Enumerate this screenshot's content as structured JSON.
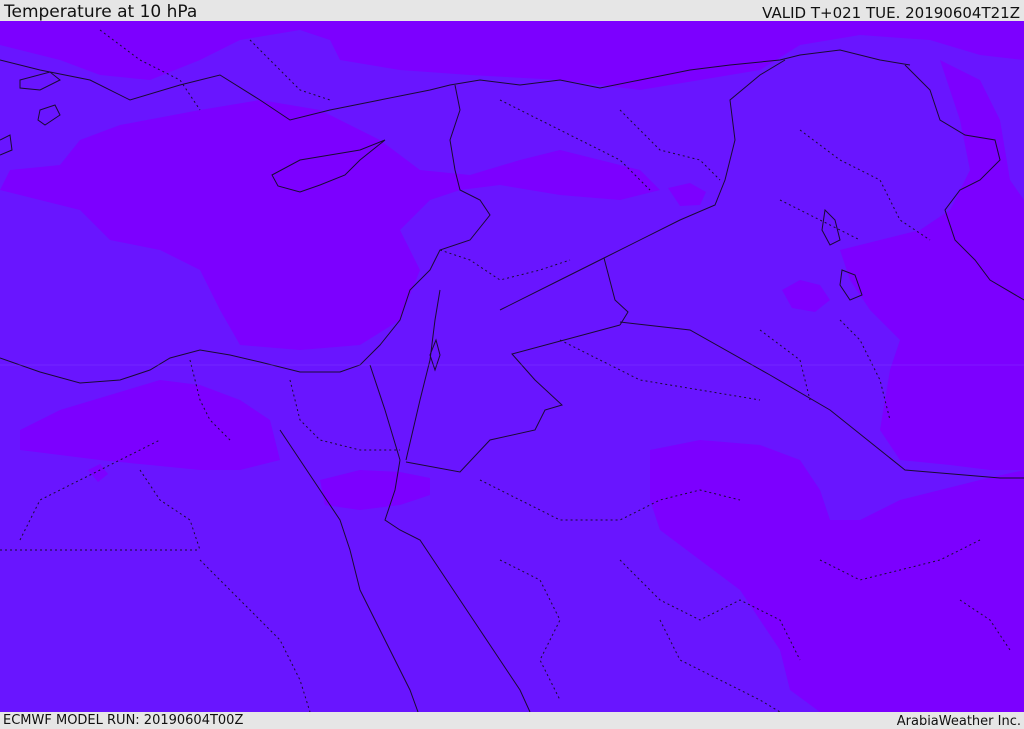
{
  "header": {
    "title": "Temperature at 10 hPa",
    "valid_time": "VALID T+021 TUE. 20190604T21Z"
  },
  "footer": {
    "model_run": "ECMWF MODEL RUN: 20190604T00Z",
    "credit": "ArabiaWeather Inc."
  },
  "map": {
    "field_colors": {
      "base": "#6915ff",
      "warmer": "#7c00ff"
    },
    "border_color": "#1a0a33"
  }
}
